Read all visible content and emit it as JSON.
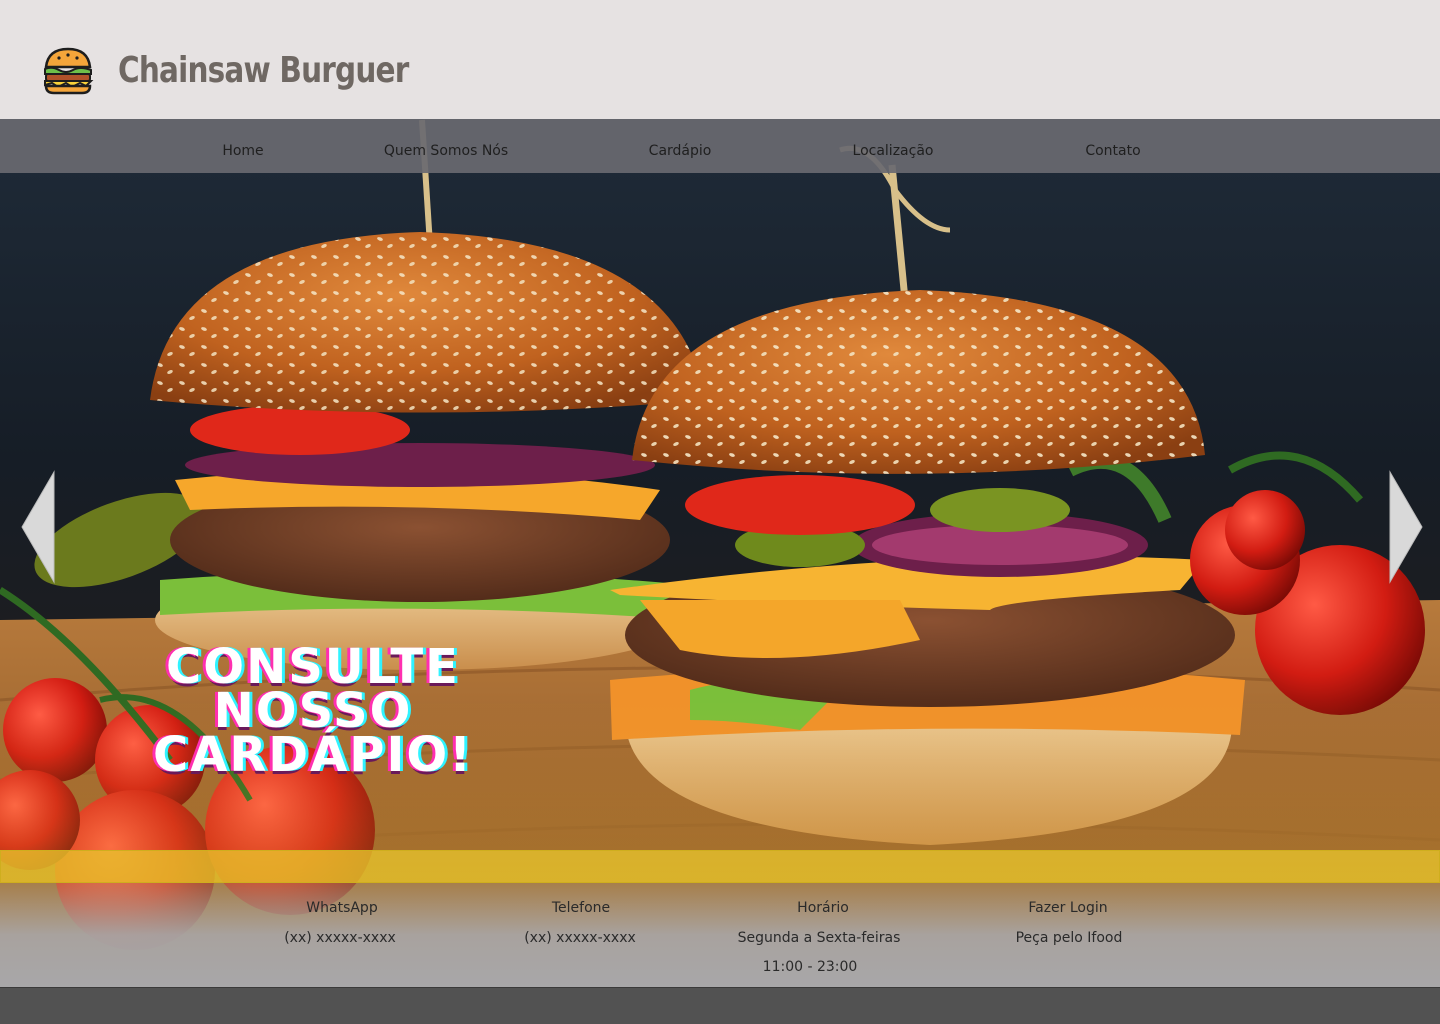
{
  "header": {
    "brand_name": "Chainsaw Burguer",
    "logo_icon": "burger-icon"
  },
  "nav": {
    "items": [
      {
        "label": "Home"
      },
      {
        "label": "Quem Somos Nós"
      },
      {
        "label": "Cardápio"
      },
      {
        "label": "Localização"
      },
      {
        "label": "Contato"
      }
    ]
  },
  "hero": {
    "image": "burger-photo",
    "cta": "Consulte nosso cardápio!",
    "prev_icon": "chevron-left-icon",
    "next_icon": "chevron-right-icon"
  },
  "info": {
    "whatsapp_title": "WhatsApp",
    "whatsapp_value": "(xx) xxxxx-xxxx",
    "phone_title": "Telefone",
    "phone_value": "(xx) xxxxx-xxxx",
    "hours_title": "Horário",
    "hours_days": "Segunda a Sexta-feiras",
    "hours_time": "11:00 - 23:00",
    "login_title": "Fazer Login",
    "ifood_link": "Peça pelo Ifood"
  },
  "colors": {
    "header_bg": "#e6e2e2",
    "nav_bg": "#696970",
    "strip": "#e8c42c",
    "footer_bg": "#a8a7a9",
    "bottom_bar": "#525252"
  }
}
